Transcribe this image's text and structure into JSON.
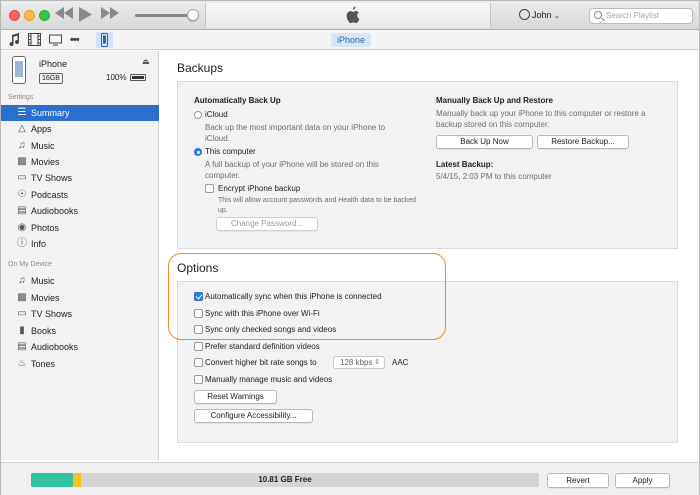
{
  "titlebar": {
    "user_name": "John",
    "search_placeholder": "Search Playlist"
  },
  "toolbar": {
    "iphone_tab": "iPhone"
  },
  "device": {
    "name": "iPhone",
    "capacity": "16GB",
    "battery": "100%"
  },
  "sidebar": {
    "settings_header": "Settings",
    "settings_items": [
      {
        "label": "Summary",
        "icon": "summary-icon"
      },
      {
        "label": "Apps",
        "icon": "apps-icon"
      },
      {
        "label": "Music",
        "icon": "music-icon"
      },
      {
        "label": "Movies",
        "icon": "movies-icon"
      },
      {
        "label": "TV Shows",
        "icon": "tv-icon"
      },
      {
        "label": "Podcasts",
        "icon": "podcasts-icon"
      },
      {
        "label": "Audiobooks",
        "icon": "audiobooks-icon"
      },
      {
        "label": "Photos",
        "icon": "photos-icon"
      },
      {
        "label": "Info",
        "icon": "info-icon"
      }
    ],
    "device_header": "On My Device",
    "device_items": [
      {
        "label": "Music",
        "icon": "music-icon"
      },
      {
        "label": "Movies",
        "icon": "movies-icon"
      },
      {
        "label": "TV Shows",
        "icon": "tv-icon"
      },
      {
        "label": "Books",
        "icon": "books-icon"
      },
      {
        "label": "Audiobooks",
        "icon": "audiobooks-icon"
      },
      {
        "label": "Tones",
        "icon": "tones-icon"
      }
    ]
  },
  "backups": {
    "title": "Backups",
    "auto_title": "Automatically Back Up",
    "icloud_label": "iCloud",
    "icloud_desc": "Back up the most important data on your iPhone to iCloud.",
    "computer_label": "This computer",
    "computer_desc": "A full backup of your iPhone will be stored on this computer.",
    "encrypt_label": "Encrypt iPhone backup",
    "encrypt_desc": "This will allow account passwords and Health data to be backed up.",
    "change_password": "Change Password...",
    "manual_title": "Manually Back Up and Restore",
    "manual_desc": "Manually back up your iPhone to this computer or restore a backup stored on this computer.",
    "backup_now": "Back Up Now",
    "restore_backup": "Restore Backup...",
    "latest_title": "Latest Backup:",
    "latest_value": "5/4/15, 2:03 PM to this computer"
  },
  "options": {
    "title": "Options",
    "auto_sync": "Automatically sync when this iPhone is connected",
    "wifi_sync": "Sync with this iPhone over Wi-Fi",
    "checked_only": "Sync only checked songs and videos",
    "prefer_sd": "Prefer standard definition videos",
    "convert_bitrate": "Convert higher bit rate songs to",
    "bitrate_value": "128 kbps",
    "bitrate_format": "AAC",
    "manual_manage": "Manually manage music and videos",
    "reset_warnings": "Reset Warnings",
    "configure_accessibility": "Configure Accessibility..."
  },
  "storage": {
    "free_label": "10.81 GB Free",
    "apps_fraction": 0.082,
    "other_fraction": 0.016,
    "colors": {
      "apps": "#33c3a4",
      "other": "#f7c325",
      "free": "#d4d4d4"
    }
  },
  "footer": {
    "revert": "Revert",
    "apply": "Apply"
  },
  "colors": {
    "accent": "#2a6fcb",
    "highlight_ring": "#f08a2c"
  }
}
